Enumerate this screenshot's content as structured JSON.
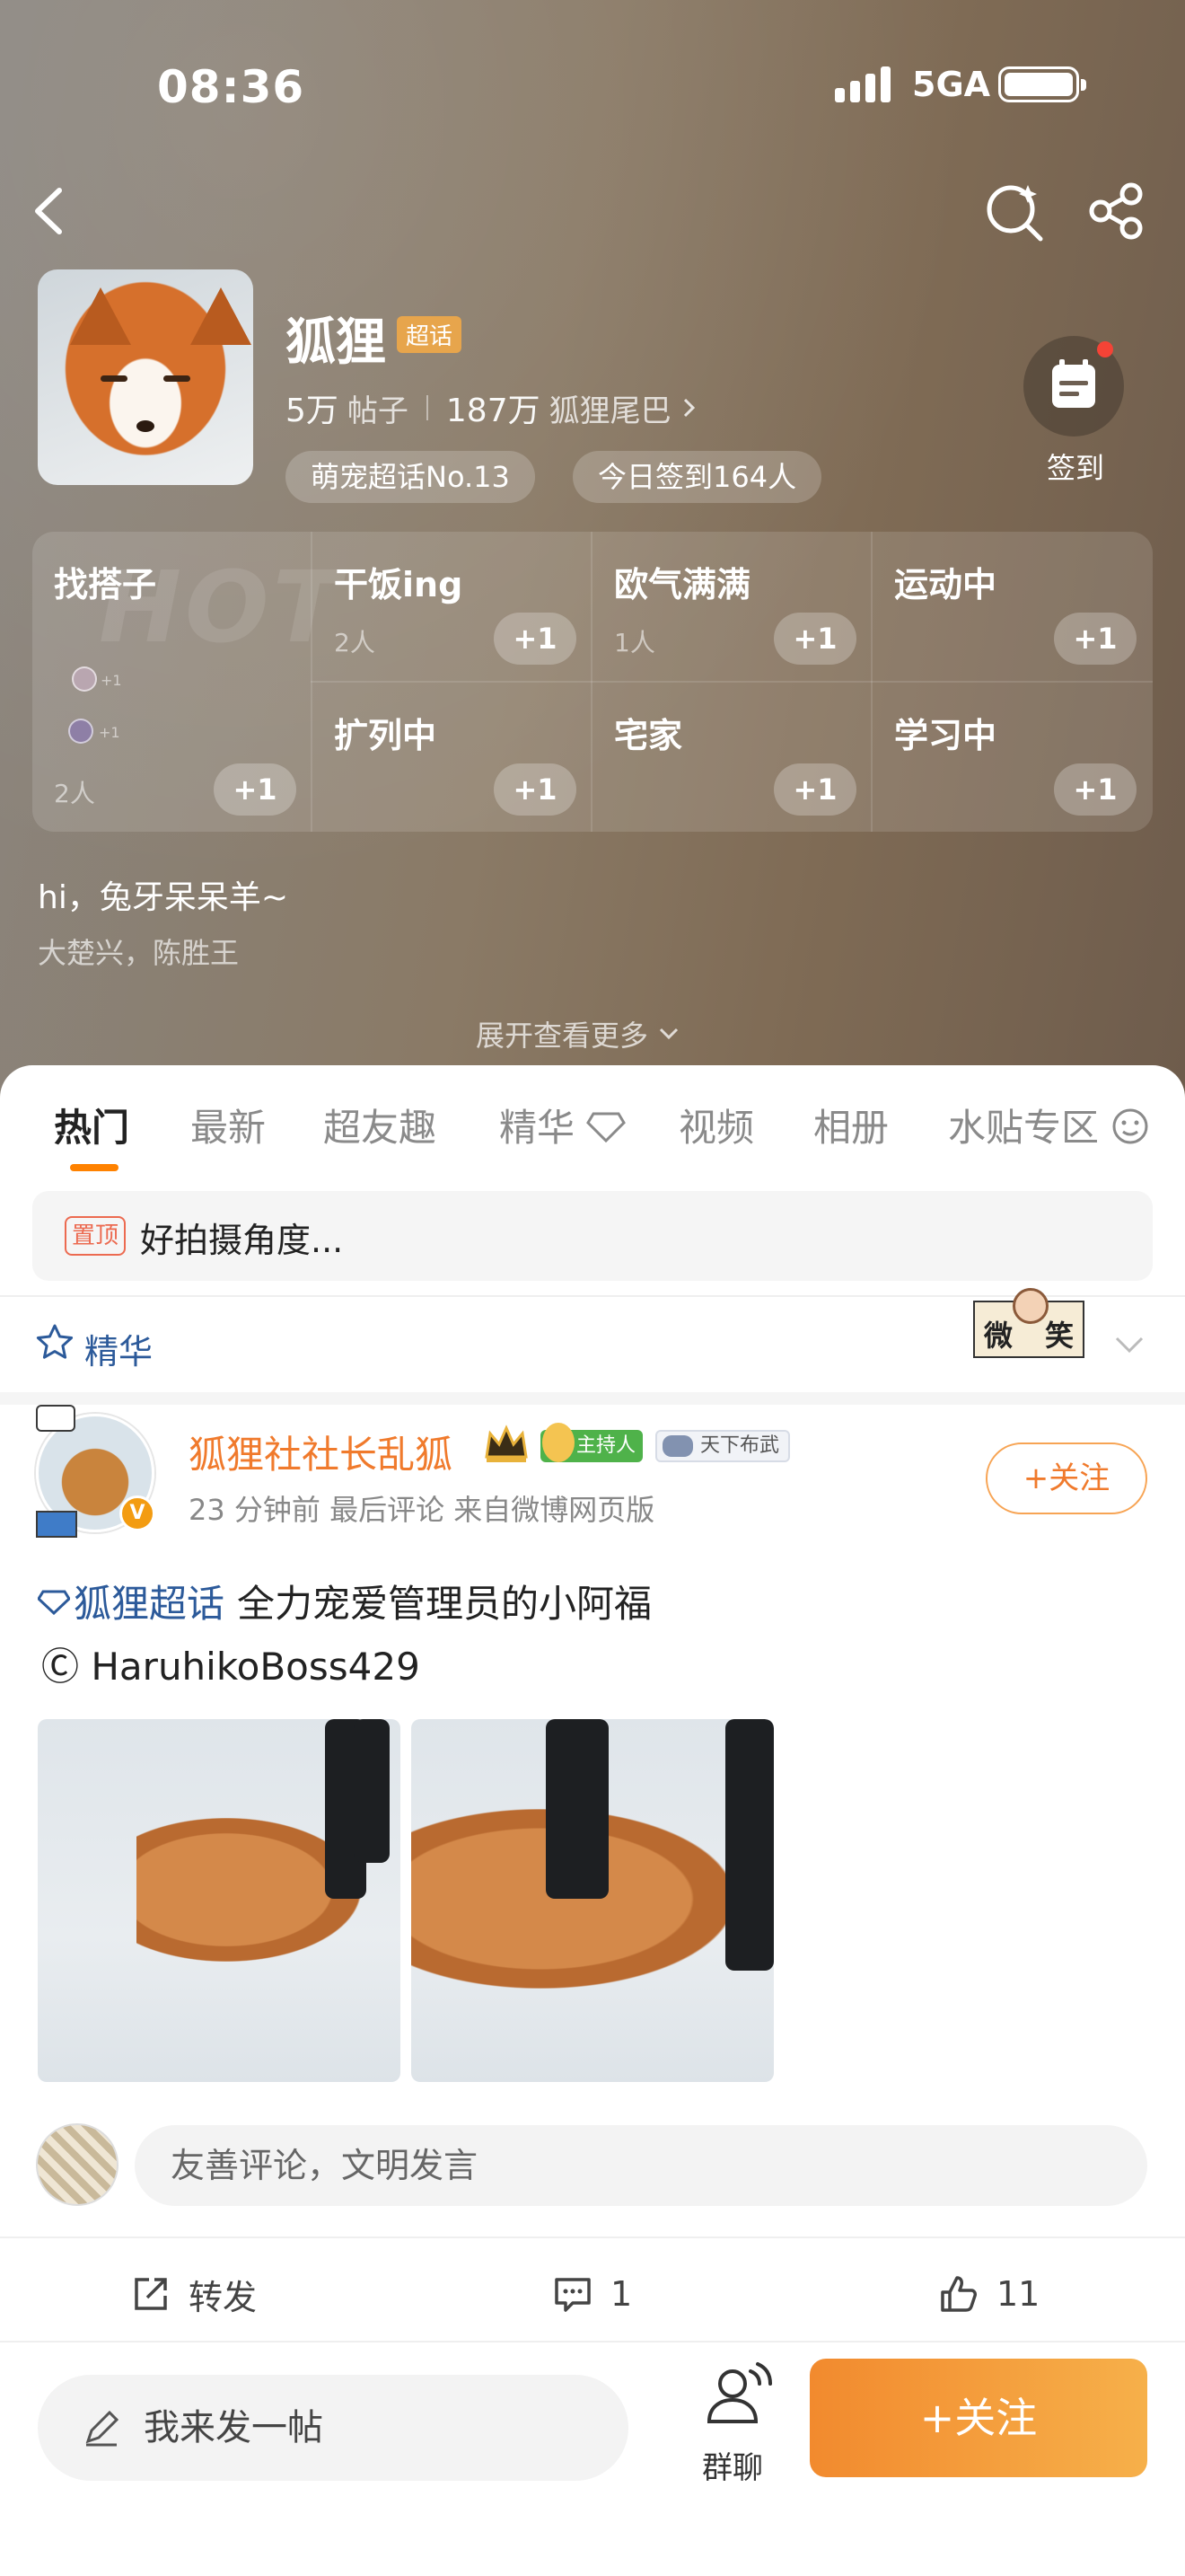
{
  "status_bar": {
    "time": "08:36",
    "network": "5GA"
  },
  "header": {
    "title": "狐狸",
    "super_badge": "超话",
    "posts_count": "5万",
    "posts_label": "帖子",
    "fans_count": "187万",
    "fans_label": "狐狸尾巴",
    "rank_chip": "萌宠超话No.13",
    "checkin_chip": "今日签到164人",
    "checkin_label": "签到"
  },
  "status_grid": {
    "watermark": "HOT",
    "items": [
      {
        "title": "找搭子",
        "count": "2人",
        "plus": "+1"
      },
      {
        "title": "干饭ing",
        "count": "2人",
        "plus": "+1"
      },
      {
        "title": "欧气满满",
        "count": "1人",
        "plus": "+1"
      },
      {
        "title": "运动中",
        "count": "",
        "plus": "+1"
      },
      {
        "title": "扩列中",
        "count": "",
        "plus": "+1"
      },
      {
        "title": "宅家",
        "count": "",
        "plus": "+1"
      },
      {
        "title": "学习中",
        "count": "",
        "plus": "+1"
      }
    ],
    "mini_tags": [
      "+1",
      "+1"
    ]
  },
  "intro": {
    "line1": "hi，兔牙呆呆羊~",
    "line2": "大楚兴，陈胜王",
    "expand_label": "展开查看更多"
  },
  "tabs": [
    "热门",
    "最新",
    "超友趣",
    "精华",
    "视频",
    "相册",
    "水贴专区"
  ],
  "active_tab": "热门",
  "pinned": {
    "tag": "置顶",
    "text": "好拍摄角度..."
  },
  "filter": {
    "label": "精华",
    "sticker_left": "微",
    "sticker_right": "笑"
  },
  "post": {
    "author": "狐狸社社长乱狐",
    "host_badge": "主持人",
    "game_badge": "天下布武",
    "meta": "23 分钟前  最后评论    来自微博网页版",
    "follow_label": "+关注",
    "topic": "狐狸超话",
    "text": "全力宠爱管理员的小阿福",
    "credit": "Ⓒ HaruhikoBoss429",
    "verified_mark": "V"
  },
  "comment": {
    "placeholder": "友善评论，文明发言"
  },
  "actions": {
    "repost": "转发",
    "comments": "1",
    "likes": "11"
  },
  "bottom_bar": {
    "compose": "我来发一帖",
    "group_chat": "群聊",
    "follow": "+关注"
  },
  "colors": {
    "accent": "#ff8200",
    "topic_blue": "#2c5a9a",
    "hero": "#8a7a66"
  }
}
